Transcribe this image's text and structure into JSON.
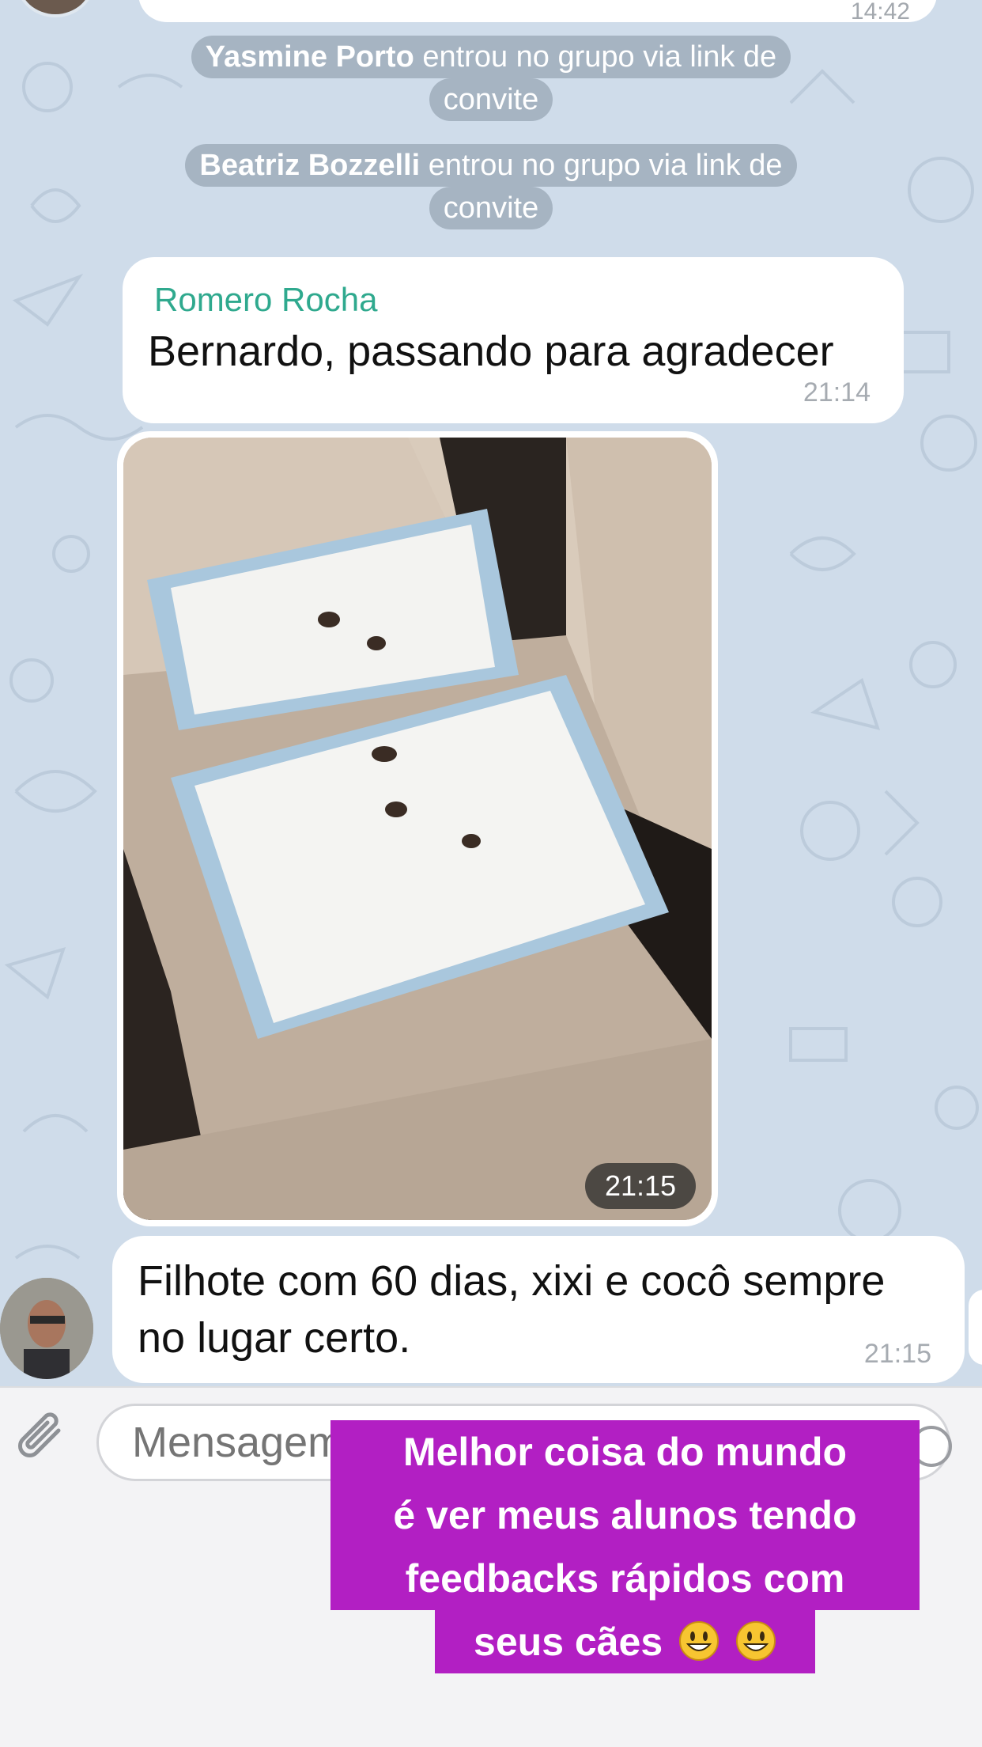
{
  "top": {
    "partial_time": "14:42"
  },
  "service_messages": [
    {
      "name": "Yasmine Porto",
      "line1": " entrou no grupo via link de",
      "line2": "convite"
    },
    {
      "name": "Beatriz Bozzelli",
      "line1": " entrou no grupo via link de",
      "line2": "convite"
    }
  ],
  "messages": [
    {
      "sender": "Romero Rocha",
      "text": "Bernardo, passando para agradecer",
      "time": "21:14"
    },
    {
      "type": "photo",
      "time": "21:15"
    },
    {
      "line1": "Filhote com 60 dias, xixi e cocô sempre",
      "line2": "no lugar certo.",
      "time": "21:15"
    }
  ],
  "input": {
    "placeholder": "Mensagem"
  },
  "caption": {
    "line1": "Melhor coisa do mundo",
    "line2": "é ver meus alunos tendo",
    "line3": "feedbacks rápidos com",
    "line4": "seus cães"
  },
  "icons": {
    "attach": "paperclip-icon",
    "send": "send-icon",
    "emoji": "grinning-face-emoji"
  },
  "colors": {
    "chat_bg": "#cfdcea",
    "sender_name": "#2fa98e",
    "caption_bg": "#b21fc3",
    "service_pill": "#a6b4c2"
  }
}
